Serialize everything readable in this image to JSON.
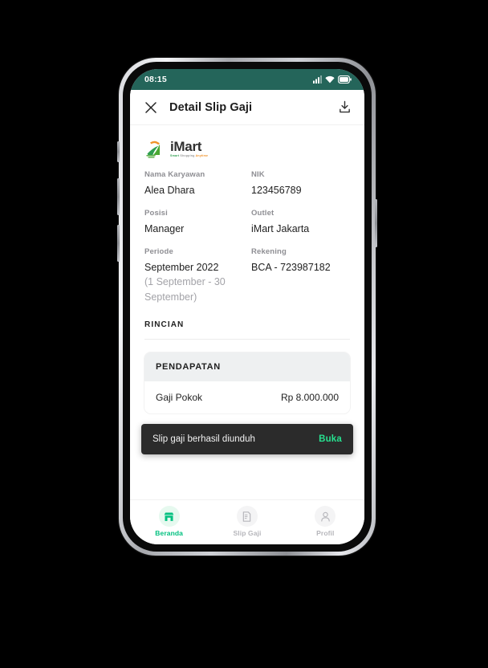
{
  "device": {
    "status_bar": {
      "time": "08:15",
      "icons": [
        "signal-icon",
        "wifi-icon",
        "battery-icon"
      ],
      "background_color": "#24655A"
    }
  },
  "appbar": {
    "close_icon": "close-icon",
    "title": "Detail Slip Gaji",
    "download_icon": "download-icon"
  },
  "brand": {
    "name": "iMart",
    "tagline_parts": [
      "Smart",
      "Shopping",
      "Anytime"
    ],
    "logo_icon": "imart-logo-icon",
    "colors": {
      "green": "#2F9E4F",
      "orange": "#F0932B"
    }
  },
  "details": [
    {
      "label": "Nama Karyawan",
      "value": "Alea Dhara",
      "sub": ""
    },
    {
      "label": "NIK",
      "value": "123456789",
      "sub": ""
    },
    {
      "label": "Posisi",
      "value": "Manager",
      "sub": ""
    },
    {
      "label": "Outlet",
      "value": "iMart Jakarta",
      "sub": ""
    },
    {
      "label": "Periode",
      "value": "September 2022",
      "sub": "(1 September - 30 September)"
    },
    {
      "label": "Rekening",
      "value": "BCA - 723987182",
      "sub": ""
    }
  ],
  "rincian": {
    "section_title": "RINCIAN",
    "card": {
      "header": "PENDAPATAN",
      "rows": [
        {
          "name": "Gaji Pokok",
          "amount": "Rp 8.000.000"
        }
      ]
    }
  },
  "snackbar": {
    "message": "Slip gaji berhasil diunduh",
    "action_label": "Buka",
    "background_color": "#2B2B2B",
    "action_color": "#27E08F"
  },
  "bottom_nav": {
    "items": [
      {
        "label": "Beranda",
        "icon": "store-icon",
        "active": true
      },
      {
        "label": "Slip Gaji",
        "icon": "document-icon",
        "active": false
      },
      {
        "label": "Profil",
        "icon": "person-icon",
        "active": false
      }
    ],
    "active_color": "#00C07F",
    "inactive_color": "#B6B6BB"
  }
}
